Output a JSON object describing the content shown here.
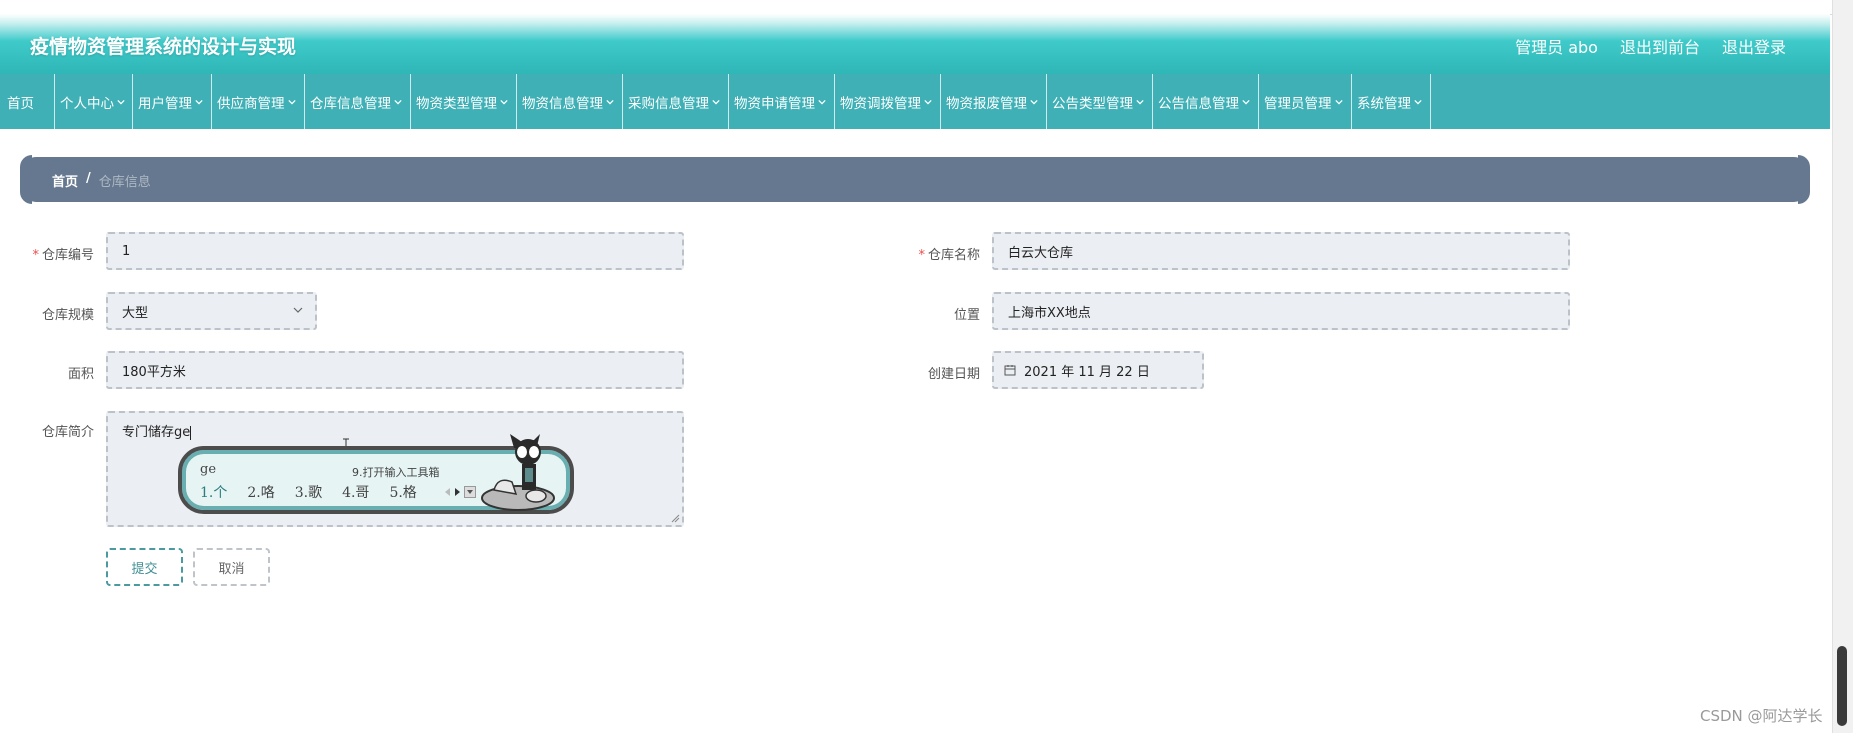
{
  "app": {
    "title": "疫情物资管理系统的设计与实现",
    "user_label": "管理员 abo",
    "frontend_link": "退出到前台",
    "logout_link": "退出登录"
  },
  "nav": [
    {
      "label": "首页",
      "has_menu": false
    },
    {
      "label": "个人中心",
      "has_menu": true
    },
    {
      "label": "用户管理",
      "has_menu": true
    },
    {
      "label": "供应商管理",
      "has_menu": true
    },
    {
      "label": "仓库信息管理",
      "has_menu": true
    },
    {
      "label": "物资类型管理",
      "has_menu": true
    },
    {
      "label": "物资信息管理",
      "has_menu": true
    },
    {
      "label": "采购信息管理",
      "has_menu": true
    },
    {
      "label": "物资申请管理",
      "has_menu": true
    },
    {
      "label": "物资调拨管理",
      "has_menu": true
    },
    {
      "label": "物资报废管理",
      "has_menu": true
    },
    {
      "label": "公告类型管理",
      "has_menu": true
    },
    {
      "label": "公告信息管理",
      "has_menu": true
    },
    {
      "label": "管理员管理",
      "has_menu": true
    },
    {
      "label": "系统管理",
      "has_menu": true
    }
  ],
  "breadcrumb": {
    "home": "首页",
    "separator": "/",
    "current": "仓库信息"
  },
  "form": {
    "warehouse_no": {
      "label": "仓库编号",
      "required": true,
      "value": "1"
    },
    "warehouse_name": {
      "label": "仓库名称",
      "required": true,
      "value": "白云大仓库"
    },
    "scale": {
      "label": "仓库规模",
      "value": "大型"
    },
    "location": {
      "label": "位置",
      "value": "上海市XX地点"
    },
    "area": {
      "label": "面积",
      "value": "180平方米"
    },
    "created_date": {
      "label": "创建日期",
      "value": "2021 年 11 月 22 日"
    },
    "intro": {
      "label": "仓库简介",
      "value": "专门储存ge"
    }
  },
  "ime": {
    "input": "ge",
    "hint": "9.打开输入工具箱",
    "candidates": [
      "1.个",
      "2.咯",
      "3.歌",
      "4.哥",
      "5.格"
    ]
  },
  "buttons": {
    "submit": "提交",
    "cancel": "取消"
  },
  "watermark": "CSDN @阿达学长",
  "colors": {
    "header": "#3fcaca",
    "nav": "#3fb0b6",
    "breadcrumb": "#66788f",
    "accent": "#4b9aa0",
    "required": "#ee4c4c"
  }
}
